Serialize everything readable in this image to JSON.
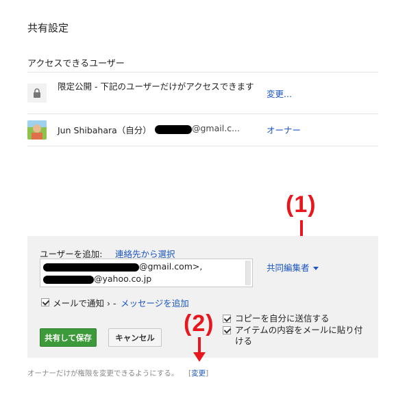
{
  "dialog": {
    "title": "共有設定",
    "access_section_label": "アクセスできるユーザー"
  },
  "access": {
    "visibility_text": "限定公開 - 下記のユーザーだけがアクセスできます",
    "change_label": "変更...",
    "lock_icon": "lock-icon"
  },
  "owner": {
    "name": "Jun Shibahara（自分）",
    "email_visible": "@gmail.c...",
    "role": "オーナー"
  },
  "add_users": {
    "label": "ユーザーを追加:",
    "contacts_link": "連絡先から選択",
    "entry_line_1": "@gmail.com>,",
    "entry_line_2": "@yahoo.co.jp",
    "role_dropdown": "共同編集者",
    "notify_label": "メールで通知 › -",
    "add_message_link": "メッセージを追加",
    "notify_checked": true
  },
  "options": {
    "copy_to_self": "コピーを自分に送信する",
    "copy_to_self_checked": true,
    "include_content": "アイテムの内容をメールに貼り付ける",
    "include_content_checked": true
  },
  "buttons": {
    "share_save": "共有して保存",
    "cancel": "キャンセル"
  },
  "footer": {
    "text": "オーナーだけが権限を変更できるようにする。",
    "bracket_open": "[",
    "change_link": "変更",
    "bracket_close": "]"
  },
  "annotations": {
    "label_1": "(1)",
    "label_2": "(2)",
    "color": "#e8161d"
  },
  "colors": {
    "link": "#1a55c0",
    "share_button": "#3d9a3a",
    "panel_bg": "#f1f1f1"
  }
}
